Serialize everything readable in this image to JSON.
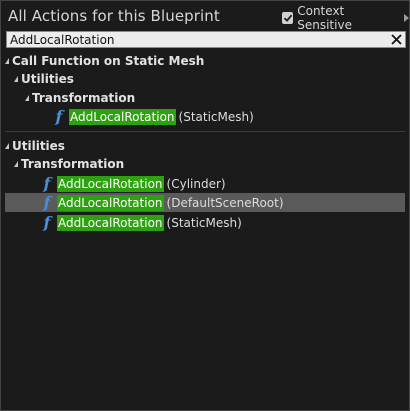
{
  "header": {
    "title": "All Actions for this Blueprint",
    "context_sensitive_label": "Context Sensitive",
    "context_sensitive_checked": true
  },
  "search": {
    "value": "AddLocalRotation"
  },
  "tree": {
    "group1": {
      "label": "Call Function on Static Mesh",
      "sub_label": "Utilities",
      "sub_sub_label": "Transformation",
      "items": [
        {
          "highlight": "AddLocalRotation",
          "context": "(StaticMesh)"
        }
      ]
    },
    "group2": {
      "label": "Utilities",
      "sub_label": "Transformation",
      "items": [
        {
          "highlight": "AddLocalRotation",
          "context": "(Cylinder)"
        },
        {
          "highlight": "AddLocalRotation",
          "context": "(DefaultSceneRoot)",
          "selected": true
        },
        {
          "highlight": "AddLocalRotation",
          "context": "(StaticMesh)"
        }
      ]
    }
  },
  "colors": {
    "highlight": "#2ea111",
    "function_icon": "#4a8ed8",
    "selected_row": "#5a5a5a"
  },
  "icons": {
    "function": "function-f-icon",
    "clear": "close-x-icon"
  }
}
